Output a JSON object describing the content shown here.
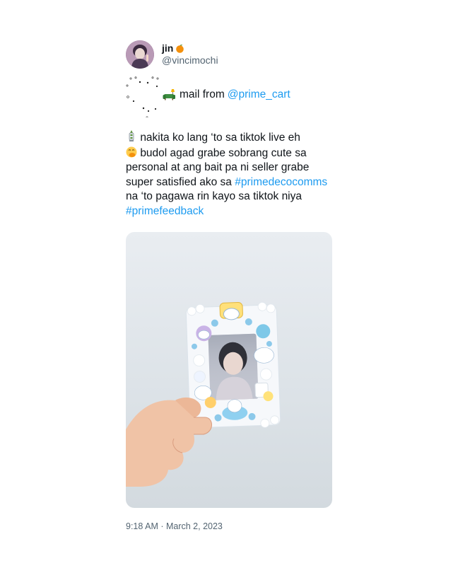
{
  "user": {
    "display_name": "jin",
    "display_name_emoji": "orange-icon",
    "handle": "@vincimochi",
    "avatar": "avatar"
  },
  "mail_line": {
    "prefix": "mail from",
    "mention": "@prime_cart",
    "emoji": "sofa-icon"
  },
  "body": {
    "line1": "nakita ko lang ‘to sa tiktok live eh",
    "line2": "budol agad grabe sobrang cute sa personal at ang bait pa ni seller grabe super satisfied ako sa",
    "hashtag1": "#primedecocomms",
    "line3": "na ‘to pagawa rin kayo sa tiktok niya",
    "hashtag2": "#primefeedback",
    "emoji1": "lantern-icon",
    "emoji2": "hand-over-mouth-icon"
  },
  "media": {
    "description_icon": "photo-decoden-frame"
  },
  "timestamp": "9:18 AM · March 2, 2023",
  "colors": {
    "link": "#1d9bf0",
    "secondary_text": "#536471",
    "text": "#0f1419"
  }
}
